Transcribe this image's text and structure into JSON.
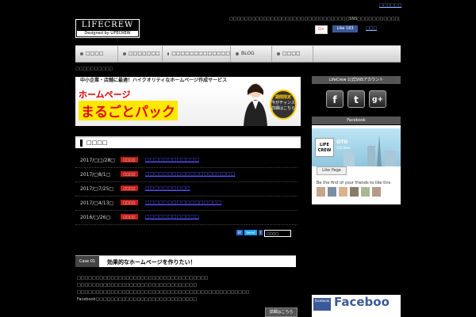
{
  "header": {
    "logo_title": "LIFECREW",
    "logo_subtitle": "Designed by LIFECREW",
    "tagline": "□□□□□□□□□□□□□□□□□□□□□□□□□□□□□□□□SNS□□□□□□□□□□□□□□□□□□□□□□□□□□□□□□□□",
    "top_link": "□□□□□□",
    "gplus_label": "G+",
    "fb_like_label": "Like 183",
    "share_link": "□□□"
  },
  "nav": {
    "items": [
      {
        "label": "□□□□"
      },
      {
        "label": "□□□□□□□"
      },
      {
        "label": "□□□□□□□□□□□□□"
      },
      {
        "label": "BLOG"
      },
      {
        "label": "□□□□"
      }
    ]
  },
  "breadcrumb": "□□□□□□□□□□",
  "banner": {
    "top_text": "中小企業・店舗に最適！ハイクオリティなホームページ作成サービス",
    "line1": "ホームページ",
    "line2": "まるごとパック",
    "circle_line1": "期間限定",
    "circle_line2": "今がチャンス",
    "circle_line3": "詳細はこちら"
  },
  "news": {
    "heading": "□□□□",
    "rows": [
      {
        "date": "2017/□□/28□",
        "badge": "□□□□",
        "title": "□□□□□□□□□□□□"
      },
      {
        "date": "2017/□8/1□",
        "badge": "□□□□",
        "title": "□□□□□□□□□□□□□□□□□□□□"
      },
      {
        "date": "2017/□7/25□",
        "badge": "□□□□",
        "title": "□□□□□□□□□□"
      },
      {
        "date": "2017/□4/13□",
        "badge": "□□□□",
        "title": "□□□□□□□□□□□□□□□□□"
      },
      {
        "date": "2016/□/26□",
        "badge": "□□□□",
        "title": "□□□□□□□□□□□□"
      }
    ]
  },
  "social_mini": [
    "B!",
    "tweet",
    "f",
    "□□□□"
  ],
  "case": {
    "tag": "Case 01",
    "title": "効果的なホームページを作りたい！",
    "lines": [
      "□□□□□□□□□□□□□□□□□□□□□□□□□□□□□□□□□□□",
      "□□□□□□□□□□□□□□□□□□□□□□□□□□□□□□□□",
      "□□□□□□□□□□□□□□□□□□□□□□□□□□□□□□□□□□□□□□□□□□□□□□",
      "Facebook□□□□□□□□□□□□□□□□□□□□□□□□□□□"
    ],
    "more_label": "詳細はこちら"
  },
  "sidebar": {
    "sns_heading": "LifeCrew 公式SNSアカウント",
    "sns_icons": [
      {
        "glyph": "f"
      },
      {
        "glyph": "t"
      },
      {
        "glyph": "g+"
      }
    ],
    "fb_heading": "Facebook",
    "fb_logo": "LIFE CREW",
    "fb_name": "OTO",
    "fb_likes": "328 likes",
    "fb_like_btn": "Like Page",
    "fb_friends": "Be the first of your friends to like this",
    "ad_small": "facebook",
    "ad_big": "Faceboo"
  }
}
